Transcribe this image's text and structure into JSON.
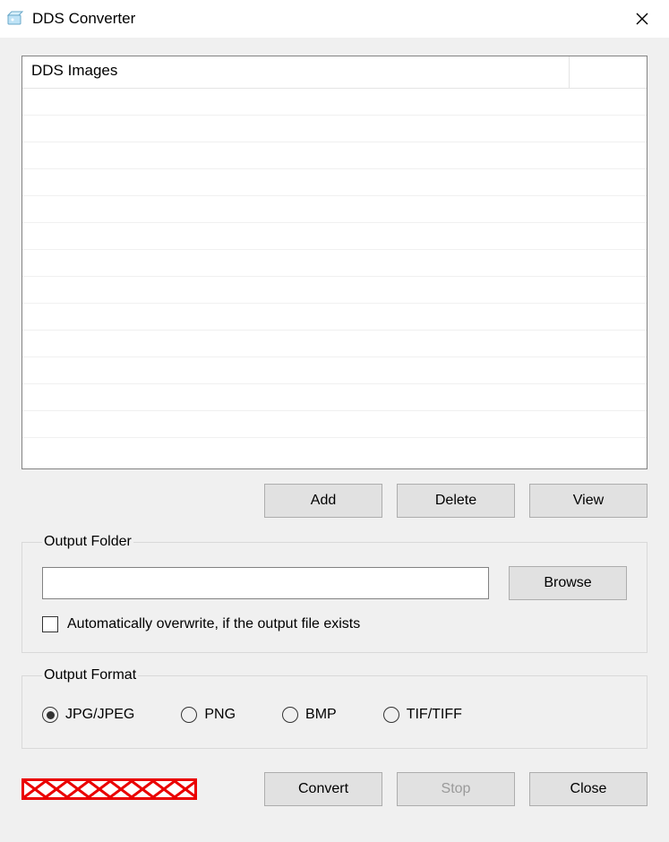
{
  "window": {
    "title": "DDS Converter"
  },
  "listview": {
    "header": "DDS Images"
  },
  "buttons": {
    "add": "Add",
    "delete": "Delete",
    "view": "View",
    "browse": "Browse",
    "convert": "Convert",
    "stop": "Stop",
    "close": "Close"
  },
  "output_folder": {
    "legend": "Output Folder",
    "path": "",
    "overwrite_checked": false,
    "overwrite_label": "Automatically overwrite, if the output file exists"
  },
  "output_format": {
    "legend": "Output Format",
    "selected": "JPG/JPEG",
    "options": {
      "jpg": "JPG/JPEG",
      "png": "PNG",
      "bmp": "BMP",
      "tif": "TIF/TIFF"
    }
  }
}
